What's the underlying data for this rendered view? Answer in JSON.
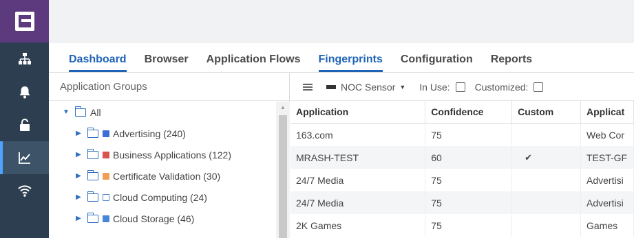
{
  "colors": {
    "rail": "#2c3e50",
    "logo_bg": "#5d3a7e",
    "accent": "#1f63b6",
    "alt_row": "#f4f5f6"
  },
  "rail": {
    "logo_icon": "extreme-logo-icon",
    "items": [
      {
        "icon": "network-tree-icon",
        "active": false
      },
      {
        "icon": "bell-icon",
        "active": false
      },
      {
        "icon": "unlock-icon",
        "active": false
      },
      {
        "icon": "analytics-chart-icon",
        "active": true
      },
      {
        "icon": "wifi-icon",
        "active": false
      }
    ]
  },
  "tabs": [
    {
      "label": "Dashboard",
      "active": true
    },
    {
      "label": "Browser",
      "active": false
    },
    {
      "label": "Application Flows",
      "active": false
    },
    {
      "label": "Fingerprints",
      "active": true
    },
    {
      "label": "Configuration",
      "active": false
    },
    {
      "label": "Reports",
      "active": false
    }
  ],
  "tree": {
    "header": "Application Groups",
    "root": {
      "label": "All",
      "expanded": true
    },
    "items": [
      {
        "label": "Advertising (240)",
        "icon": "advertising-icon",
        "color": "#3b6fd6"
      },
      {
        "label": "Business Applications (122)",
        "icon": "business-icon",
        "color": "#d9534f"
      },
      {
        "label": "Certificate Validation (30)",
        "icon": "certificate-icon",
        "color": "#f0a050"
      },
      {
        "label": "Cloud Computing (24)",
        "icon": "cloud-computing-icon",
        "color": "#4a86d8"
      },
      {
        "label": "Cloud Storage (46)",
        "icon": "cloud-storage-icon",
        "color": "#4a86d8"
      }
    ]
  },
  "toolbar": {
    "sensor_label": "NOC Sensor",
    "in_use_label": "In Use:",
    "customized_label": "Customized:"
  },
  "table": {
    "columns": [
      "Application",
      "Confidence",
      "Custom",
      "Applicat"
    ],
    "rows": [
      {
        "application": "163.com",
        "confidence": "75",
        "custom": "",
        "group": "Web Cor"
      },
      {
        "application": "MRASH-TEST",
        "confidence": "60",
        "custom": "✔",
        "group": "TEST-GF"
      },
      {
        "application": "24/7 Media",
        "confidence": "75",
        "custom": "",
        "group": "Advertisi"
      },
      {
        "application": "24/7 Media",
        "confidence": "75",
        "custom": "",
        "group": "Advertisi"
      },
      {
        "application": "2K Games",
        "confidence": "75",
        "custom": "",
        "group": "Games"
      }
    ]
  }
}
